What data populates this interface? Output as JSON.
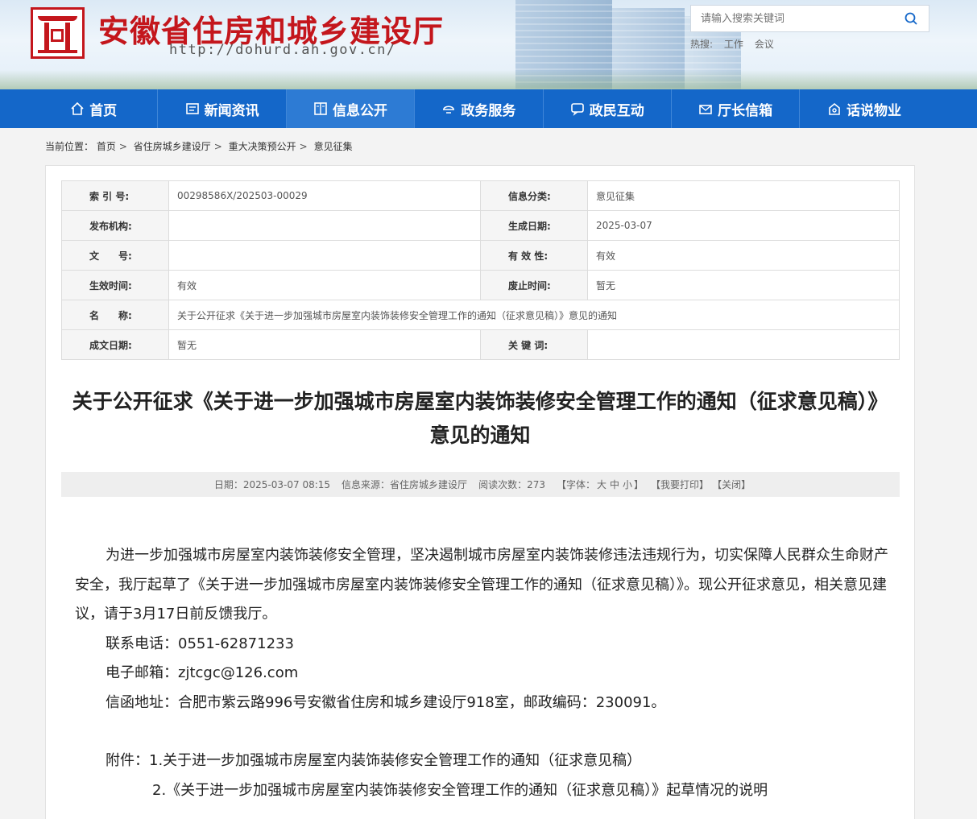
{
  "header": {
    "site_title": "安徽省住房和城乡建设厅",
    "site_url": "http://dohurd.ah.gov.cn/",
    "search_placeholder": "请输入搜索关键词",
    "hot_label": "热搜:",
    "hot_words": [
      "工作",
      "会议"
    ],
    "brand_color": "#c4161c"
  },
  "nav": {
    "color": "#1467c9",
    "items": [
      {
        "label": "首页",
        "icon": "home-icon"
      },
      {
        "label": "新闻资讯",
        "icon": "news-icon"
      },
      {
        "label": "信息公开",
        "icon": "book-icon"
      },
      {
        "label": "政务服务",
        "icon": "service-icon"
      },
      {
        "label": "政民互动",
        "icon": "chat-icon"
      },
      {
        "label": "厅长信箱",
        "icon": "mailbox-icon"
      },
      {
        "label": "话说物业",
        "icon": "property-icon"
      }
    ]
  },
  "breadcrumb": {
    "prefix": "当前位置：",
    "items": [
      "首页",
      "省住房城乡建设厅",
      "重大决策预公开",
      "意见征集"
    ]
  },
  "meta": {
    "rows": [
      {
        "l1": "索 引 号:",
        "v1": "00298586X/202503-00029",
        "l2": "信息分类:",
        "v2": "意见征集"
      },
      {
        "l1": "发布机构:",
        "v1": "",
        "l2": "生成日期:",
        "v2": "2025-03-07"
      },
      {
        "l1": "文　　号:",
        "v1": "",
        "l2": "有 效 性:",
        "v2": "有效"
      },
      {
        "l1": "生效时间:",
        "v1": "有效",
        "l2": "废止时间:",
        "v2": "暂无"
      },
      {
        "l1": "名　　称:",
        "v1": "关于公开征求《关于进一步加强城市房屋室内装饰装修安全管理工作的通知（征求意见稿）》意见的通知"
      },
      {
        "l1": "成文日期:",
        "v1": "暂无",
        "l2": "关 键 词:",
        "v2": ""
      }
    ]
  },
  "article": {
    "title": "关于公开征求《关于进一步加强城市房屋室内装饰装修安全管理工作的通知（征求意见稿）》意见的通知",
    "info": {
      "date": "日期：2025-03-07 08:15",
      "source": "信息来源：省住房城乡建设厅",
      "views": "阅读次数：273",
      "font_label": "【字体：",
      "font_big": "大",
      "font_mid": "中",
      "font_small": "小",
      "font_end": "】",
      "print": "【我要打印】",
      "close": "【关闭】"
    },
    "para1": "为进一步加强城市房屋室内装饰装修安全管理，坚决遏制城市房屋室内装饰装修违法违规行为，切实保障人民群众生命财产安全，我厅起草了《关于进一步加强城市房屋室内装饰装修安全管理工作的通知（征求意见稿）》。现公开征求意见，相关意见建议，请于3月17日前反馈我厅。",
    "phone": "联系电话：0551-62871233",
    "email": "电子邮箱：zjtcgc@126.com",
    "address": "信函地址：合肥市紫云路996号安徽省住房和城乡建设厅918室，邮政编码：230091。",
    "attach1": "附件：1.关于进一步加强城市房屋室内装饰装修安全管理工作的通知（征求意见稿）",
    "attach2": "2.《关于进一步加强城市房屋室内装饰装修安全管理工作的通知（征求意见稿）》起草情况的说明"
  }
}
